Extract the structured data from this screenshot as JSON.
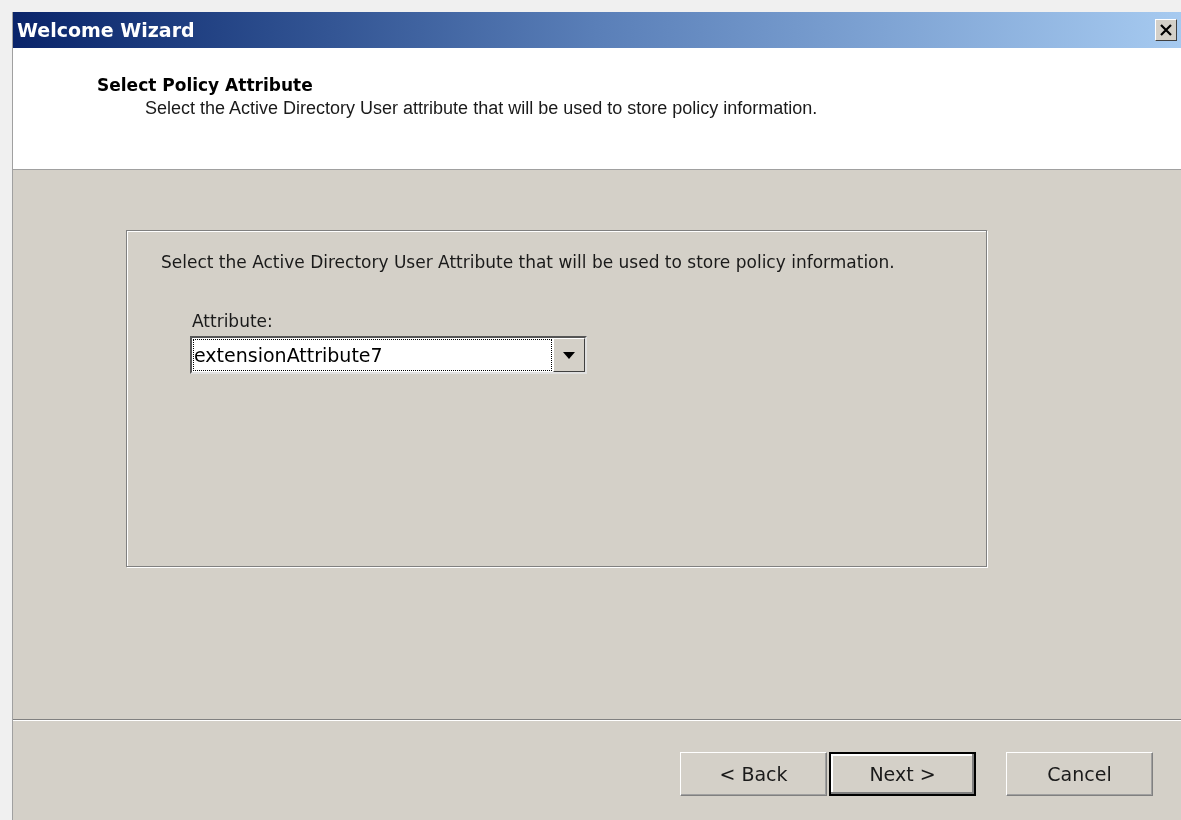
{
  "window": {
    "title": "Welcome Wizard"
  },
  "header": {
    "title": "Select Policy Attribute",
    "subtitle": "Select the Active Directory User attribute that will be used to store policy information."
  },
  "panel": {
    "description": "Select the Active Directory User Attribute that will be used to store policy information.",
    "field_label": "Attribute:",
    "dropdown": {
      "value": "extensionAttribute7",
      "focused": true
    }
  },
  "buttons": [
    {
      "label": "< Back",
      "default": false
    },
    {
      "label": "Next >",
      "default": true
    },
    {
      "label": "Cancel",
      "default": false
    }
  ]
}
